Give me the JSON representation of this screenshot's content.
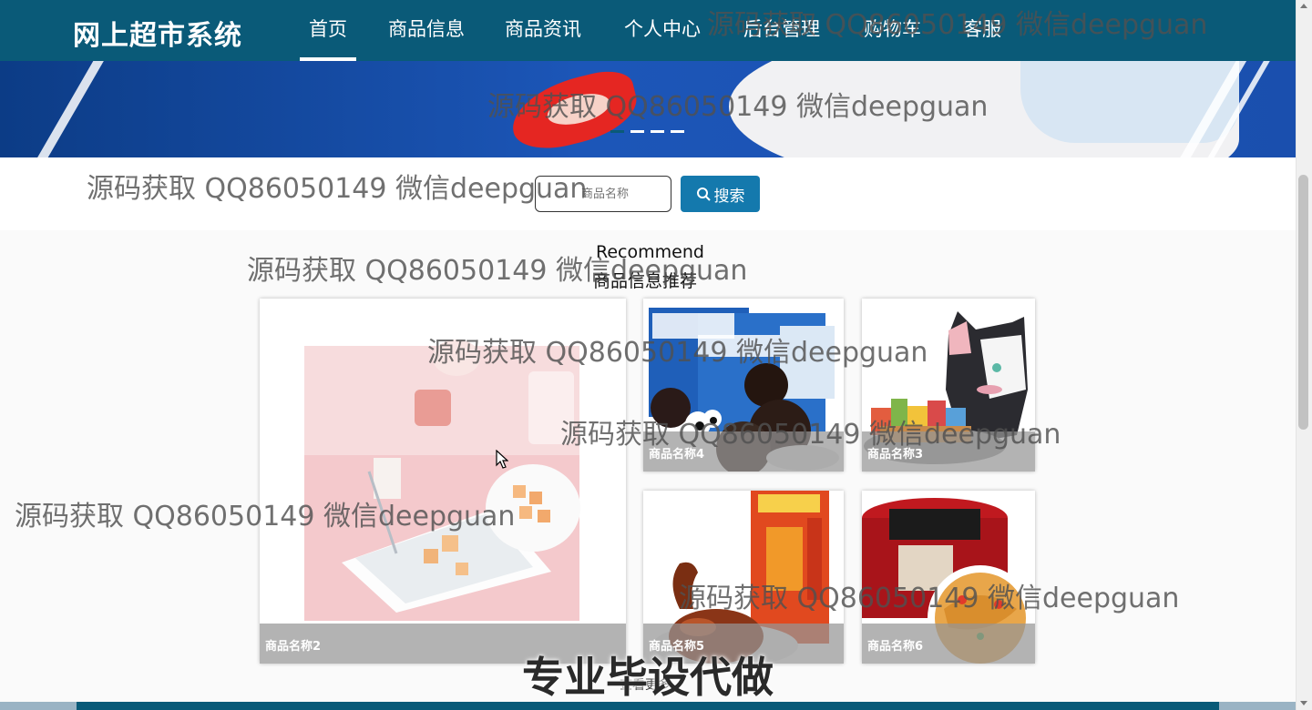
{
  "header": {
    "logo": "网上超市系统",
    "nav": [
      "首页",
      "商品信息",
      "商品资讯",
      "个人中心",
      "后台管理",
      "购物车",
      "客服"
    ],
    "active_nav": "首页",
    "bg_color": "#0a5a78"
  },
  "banner": {
    "slide_count": 4,
    "active_slide": 1
  },
  "search": {
    "placeholder": "商品名称",
    "button_label": "搜索",
    "icon": "search-icon"
  },
  "recommend": {
    "title_en": "Recommend",
    "title_cn": "商品信息推荐",
    "items": [
      {
        "name": "商品名称2"
      },
      {
        "name": "商品名称4"
      },
      {
        "name": "商品名称3"
      },
      {
        "name": "商品名称5"
      },
      {
        "name": "商品名称6"
      }
    ],
    "more_label": "查看更多"
  },
  "watermarks": {
    "text": "源码获取 QQ86050149 微信deepguan",
    "big_text": "专业毕设代做"
  },
  "colors": {
    "accent": "#1479ad",
    "header": "#0a5a78"
  }
}
